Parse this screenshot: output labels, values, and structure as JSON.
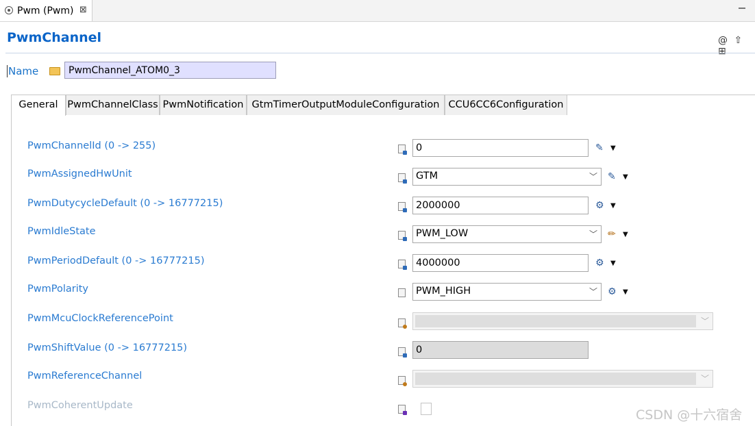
{
  "editor_tab": {
    "label": "Pwm (Pwm)",
    "close": "⊠"
  },
  "header": {
    "title": "PwmChannel",
    "icons": [
      "@",
      "⇧",
      "⊞"
    ]
  },
  "name": {
    "label": "Name",
    "value": "PwmChannel_ATOM0_3"
  },
  "tabs": [
    {
      "label": "General",
      "active": true
    },
    {
      "label": "PwmChannelClass"
    },
    {
      "label": "PwmNotification"
    },
    {
      "label": "GtmTimerOutputModuleConfiguration"
    },
    {
      "label": "CCU6CC6Configuration"
    }
  ],
  "params": [
    {
      "label": "PwmChannelId (0 -> 255)",
      "kind": "text",
      "value": "0"
    },
    {
      "label": "PwmAssignedHwUnit",
      "kind": "select",
      "value": "GTM"
    },
    {
      "label": "PwmDutycycleDefault (0 -> 16777215)",
      "kind": "text",
      "value": "2000000"
    },
    {
      "label": "PwmIdleState",
      "kind": "select",
      "value": "PWM_LOW"
    },
    {
      "label": "PwmPeriodDefault (0 -> 16777215)",
      "kind": "text",
      "value": "4000000"
    },
    {
      "label": "PwmPolarity",
      "kind": "select",
      "value": "PWM_HIGH"
    },
    {
      "label": "PwmMcuClockReferencePoint",
      "kind": "select-disabled",
      "value": ""
    },
    {
      "label": "PwmShiftValue (0 -> 16777215)",
      "kind": "text-disabled",
      "value": "0"
    },
    {
      "label": "PwmReferenceChannel",
      "kind": "select-disabled",
      "value": ""
    },
    {
      "label": "PwmCoherentUpdate",
      "kind": "checkbox",
      "value": ""
    }
  ],
  "watermark": "CSDN @十六宿舍"
}
